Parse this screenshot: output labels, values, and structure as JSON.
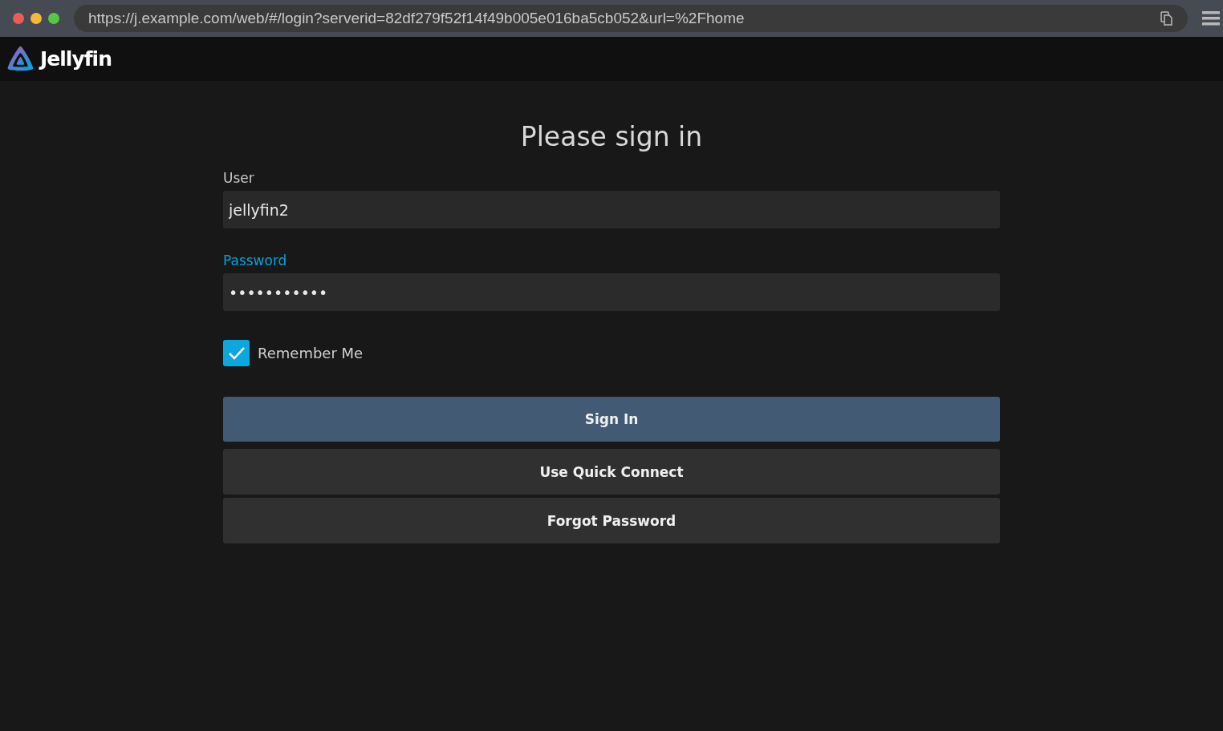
{
  "browser": {
    "url": "https://j.example.com/web/#/login?serverid=82df279f52f14f49b005e016ba5cb052&url=%2Fhome"
  },
  "header": {
    "logo_text": "Jellyfin"
  },
  "login": {
    "title": "Please sign in",
    "fields": [
      {
        "label": "User",
        "value": "jellyfin2",
        "focused": false
      },
      {
        "label": "Password",
        "value": "•••••••••••",
        "focused": true
      }
    ],
    "remember": {
      "label": "Remember Me",
      "checked": true
    },
    "buttons": [
      {
        "label": "Sign In",
        "kind": "primary"
      },
      {
        "label": "Use Quick Connect",
        "kind": "secondary"
      },
      {
        "label": "Forgot Password",
        "kind": "secondary"
      }
    ]
  }
}
